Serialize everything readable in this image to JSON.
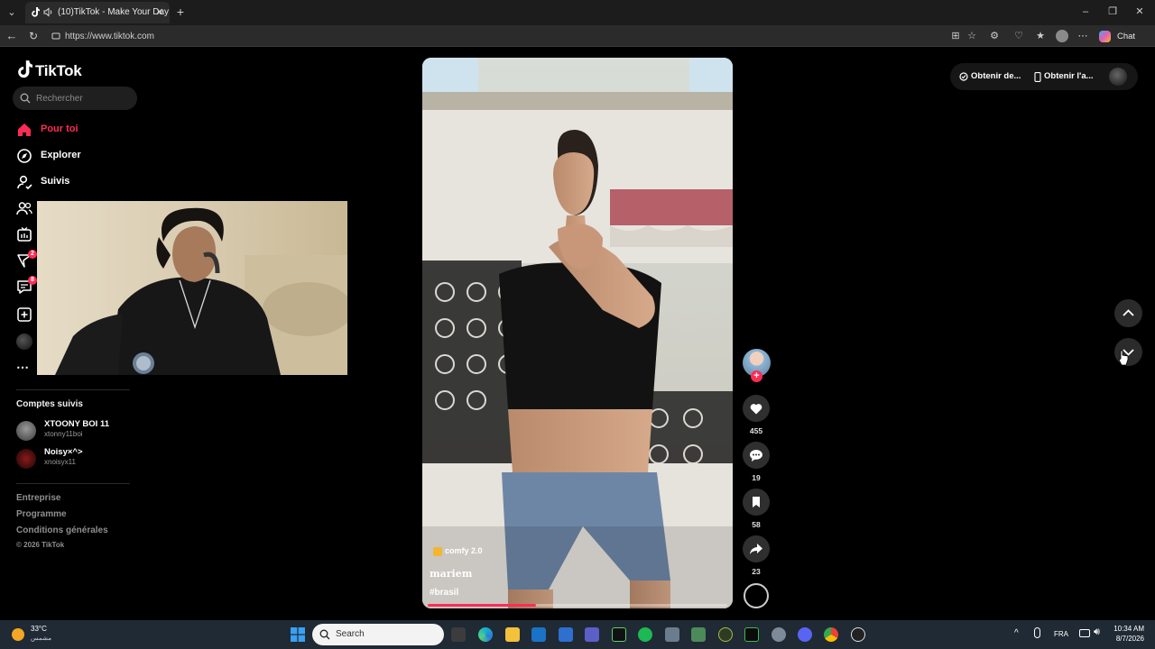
{
  "browser": {
    "tab_title": "(10)TikTok - Make Your Day",
    "url": "https://www.tiktok.com",
    "chat_label": "Chat"
  },
  "sidebar": {
    "logo": "TikTok",
    "search_placeholder": "Rechercher",
    "nav": [
      {
        "label": "Pour toi",
        "icon": "home-icon",
        "active": true
      },
      {
        "label": "Explorer",
        "icon": "compass-icon"
      },
      {
        "label": "Suivis",
        "icon": "following-icon"
      },
      {
        "label": "",
        "icon": "friends-icon"
      },
      {
        "label": "",
        "icon": "live-icon"
      },
      {
        "label": "",
        "icon": "activity-icon",
        "badge": "2"
      },
      {
        "label": "",
        "icon": "messages-icon",
        "badge": "8"
      },
      {
        "label": "",
        "icon": "upload-icon"
      },
      {
        "label": "",
        "icon": "profile-icon"
      },
      {
        "label": "",
        "icon": "more-icon"
      }
    ],
    "following_title": "Comptes suivis",
    "accounts": [
      {
        "name": "XTOONY BOI 11",
        "username": "xtonny11boi"
      },
      {
        "name": "Noisy×^>",
        "username": "xnoisyx11"
      }
    ],
    "footer": [
      "Entreprise",
      "Programme",
      "Conditions générales"
    ],
    "copyright": "© 2026 TikTok"
  },
  "video": {
    "music": "comfy 2.0",
    "author": "mariem",
    "hashtag": "#brasil",
    "progress": 0.36
  },
  "actions": {
    "likes": "455",
    "comments": "19",
    "saves": "58",
    "shares": "23"
  },
  "top_actions": {
    "get_coins": "Obtenir de...",
    "get_app": "Obtenir l'a..."
  },
  "taskbar": {
    "temperature": "33°C",
    "weather_desc": "مشمس",
    "search_placeholder": "Search",
    "language": "FRA",
    "time": "10:34 AM",
    "date": "8/7/2026"
  },
  "colors": {
    "accent": "#fe2c55",
    "background": "#000000"
  }
}
